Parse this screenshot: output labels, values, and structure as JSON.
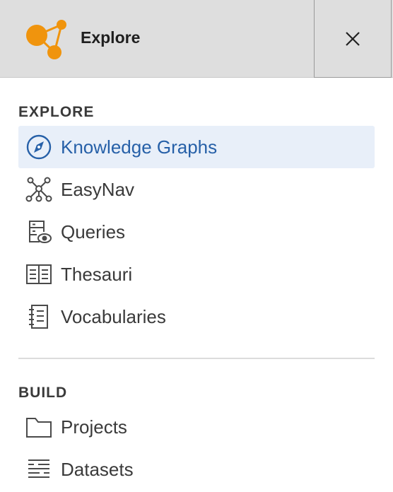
{
  "header": {
    "title": "Explore",
    "logo_icon": "network-graph-logo-icon",
    "close_icon": "close-icon",
    "accent_color": "#f0940d"
  },
  "sections": {
    "explore": {
      "heading": "EXPLORE",
      "items": [
        {
          "label": "Knowledge Graphs",
          "icon": "compass-icon",
          "active": true
        },
        {
          "label": "EasyNav",
          "icon": "network-nodes-icon",
          "active": false
        },
        {
          "label": "Queries",
          "icon": "query-view-icon",
          "active": false
        },
        {
          "label": "Thesauri",
          "icon": "open-book-icon",
          "active": false
        },
        {
          "label": "Vocabularies",
          "icon": "notebook-icon",
          "active": false
        }
      ]
    },
    "build": {
      "heading": "BUILD",
      "items": [
        {
          "label": "Projects",
          "icon": "folder-icon",
          "active": false
        },
        {
          "label": "Datasets",
          "icon": "dataset-lines-icon",
          "active": false
        }
      ]
    }
  },
  "colors": {
    "active_text": "#2660a8",
    "active_bg": "#e8eff9",
    "header_bg": "#dedede"
  }
}
